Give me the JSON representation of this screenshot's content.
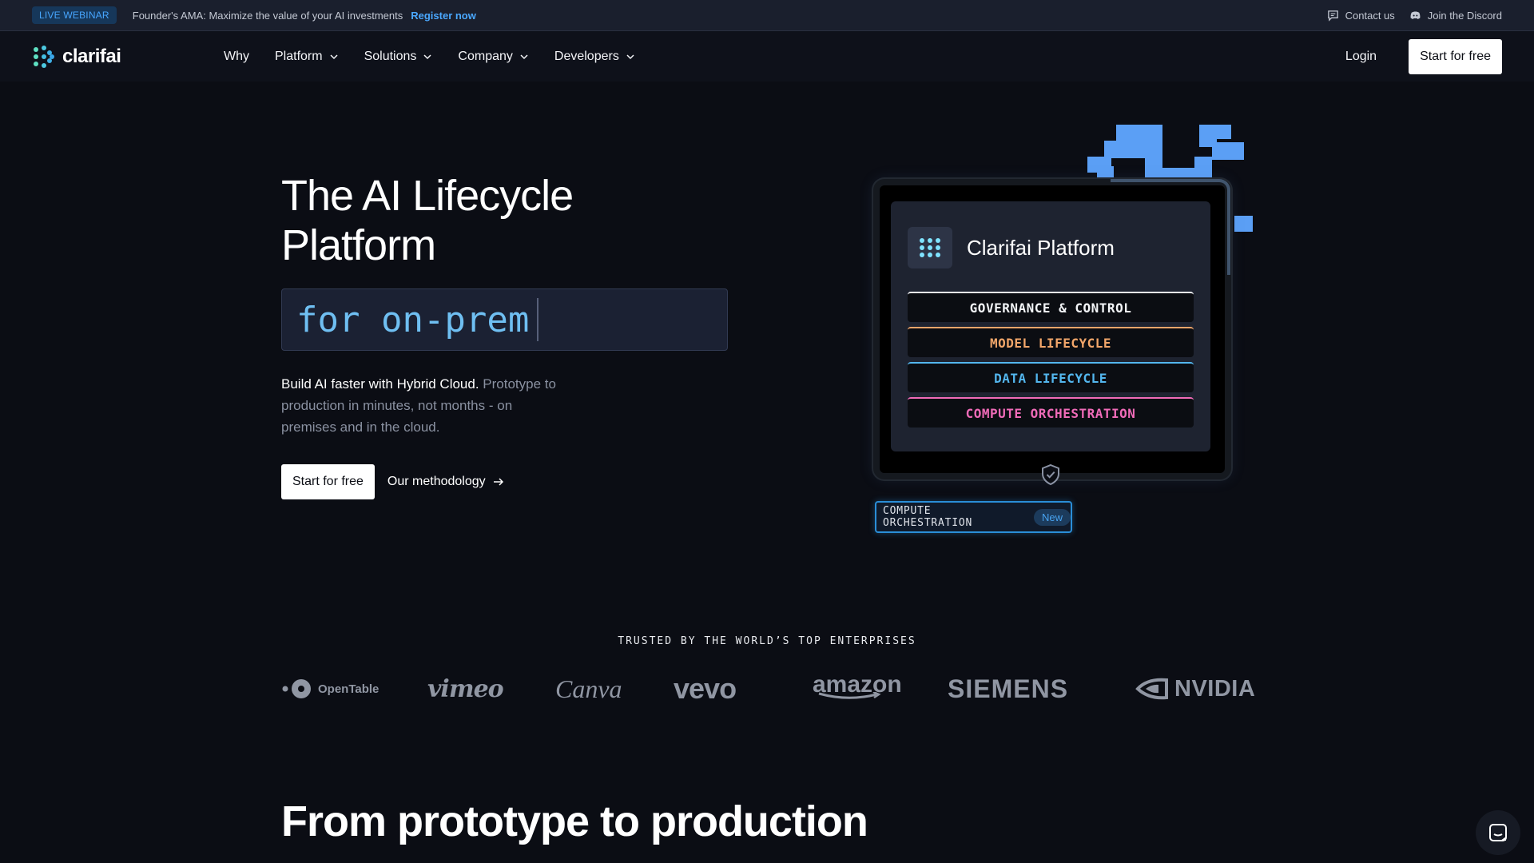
{
  "announcement": {
    "badge": "LIVE WEBINAR",
    "message": "Founder's AMA: Maximize the value of your AI investments",
    "cta": "Register now",
    "contact": "Contact us",
    "discord": "Join the Discord"
  },
  "nav": {
    "brand": "clarifai",
    "items": [
      "Why",
      "Platform",
      "Solutions",
      "Company",
      "Developers"
    ],
    "login": "Login",
    "start": "Start for free"
  },
  "hero": {
    "title_line1": "The AI Lifecycle",
    "title_line2": "Platform",
    "typed_text": "for on-prem",
    "desc_strong": "Build AI faster with Hybrid Cloud.",
    "desc_rest": " Prototype to production in minutes, not months - on premises and in the cloud.",
    "cta_primary": "Start for free",
    "cta_secondary": "Our methodology"
  },
  "illustration": {
    "panel_title": "Clarifai Platform",
    "layers": [
      {
        "label": "GOVERNANCE & CONTROL",
        "color": "#f2f4f7"
      },
      {
        "label": "MODEL LIFECYCLE",
        "color": "#f2a66a"
      },
      {
        "label": "DATA LIFECYCLE",
        "color": "#53b6ee"
      },
      {
        "label": "COMPUTE ORCHESTRATION",
        "color": "#f06bb8"
      }
    ],
    "badge_label": "COMPUTE ORCHESTRATION",
    "badge_tag": "New"
  },
  "trusted": {
    "heading": "TRUSTED BY THE WORLD’S TOP ENTERPRISES",
    "logos": [
      "OpenTable",
      "vimeo",
      "Canva",
      "vevo",
      "amazon",
      "SIEMENS",
      "NVIDIA"
    ]
  },
  "next_section": {
    "title": "From prototype to production"
  },
  "colors": {
    "background": "#0b0d14",
    "accent_blue": "#5b9ff5",
    "link_blue": "#4aa8ff"
  },
  "icons": [
    "clarifai-logo-icon",
    "chat-bubble-icon",
    "discord-icon",
    "chevron-down-icon",
    "arrow-right-icon",
    "shield-check-icon",
    "messenger-icon"
  ]
}
